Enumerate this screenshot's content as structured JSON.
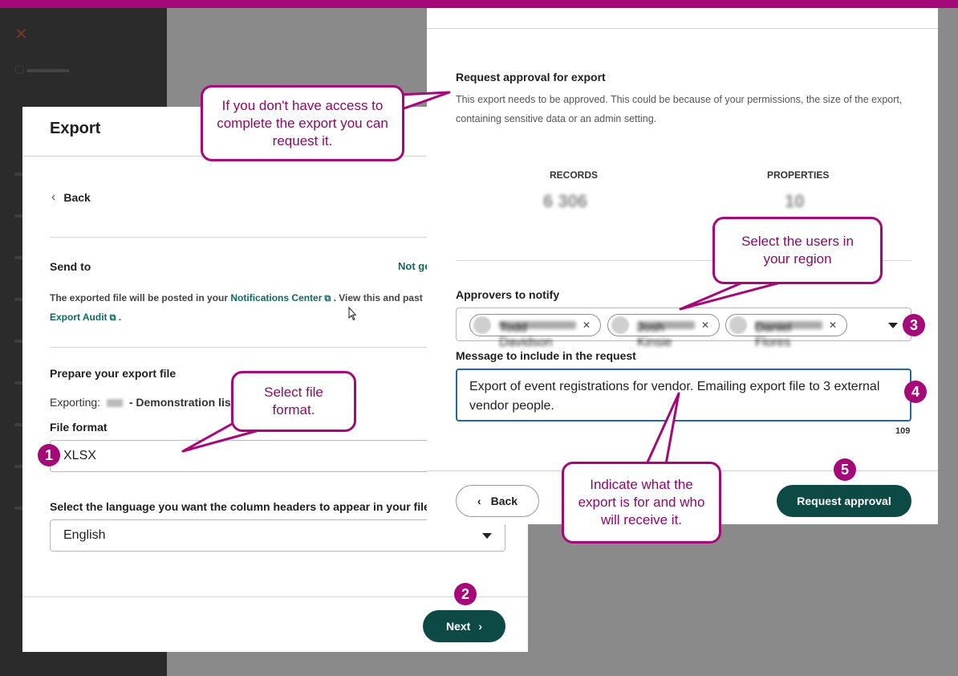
{
  "left_panel": {
    "title": "Export",
    "back_label": "Back",
    "send_to": {
      "heading": "Send to",
      "right_link": "Not ge",
      "text_before": "The exported file will be posted in your",
      "notifications_link": "Notifications Center",
      "text_after": ". View this and past",
      "audit_link": "Export Audit",
      "period": "."
    },
    "prepare": {
      "heading": "Prepare your export file",
      "exporting_label": "Exporting:",
      "exporting_value": "- Demonstration lis"
    },
    "file_format": {
      "label": "File format",
      "value": "XLSX"
    },
    "language": {
      "label": "Select the language you want the column headers to appear in your file",
      "value": "English"
    },
    "next_label": "Next"
  },
  "right_panel": {
    "heading": "Request approval for export",
    "description": "This export needs to be approved. This could be because of your permissions, the size of the export, containing sensitive data or an admin setting.",
    "stats": [
      {
        "label": "RECORDS",
        "value": "6 306"
      },
      {
        "label": "PROPERTIES",
        "value": "10"
      }
    ],
    "approvers_label": "Approvers to notify",
    "approvers": [
      {
        "name": "Todd Davidson"
      },
      {
        "name": "Josh Kinsie"
      },
      {
        "name": "Daniel Flores"
      }
    ],
    "message_label": "Message to include in the request",
    "message_value": "Export of event registrations for vendor. Emailing export file to 3 external vendor people.",
    "char_count": "109",
    "back_label": "Back",
    "request_label": "Request approval"
  },
  "callouts": {
    "access": "If you don't have access to complete the export you can request it.",
    "users": "Select the users in your region",
    "format": "Select file format.",
    "indicate": "Indicate what the export is for and who will receive it."
  },
  "steps": [
    "1",
    "2",
    "3",
    "4",
    "5"
  ],
  "colors": {
    "accent": "#a6087a",
    "primary_button": "#0d4a45",
    "link": "#0f6b62",
    "focus": "#1e6aa8"
  },
  "icons": {
    "back": "chevron-left-icon",
    "next": "chevron-right-icon",
    "external": "external-link-icon",
    "dropdown": "caret-down-icon",
    "remove": "close-icon"
  }
}
